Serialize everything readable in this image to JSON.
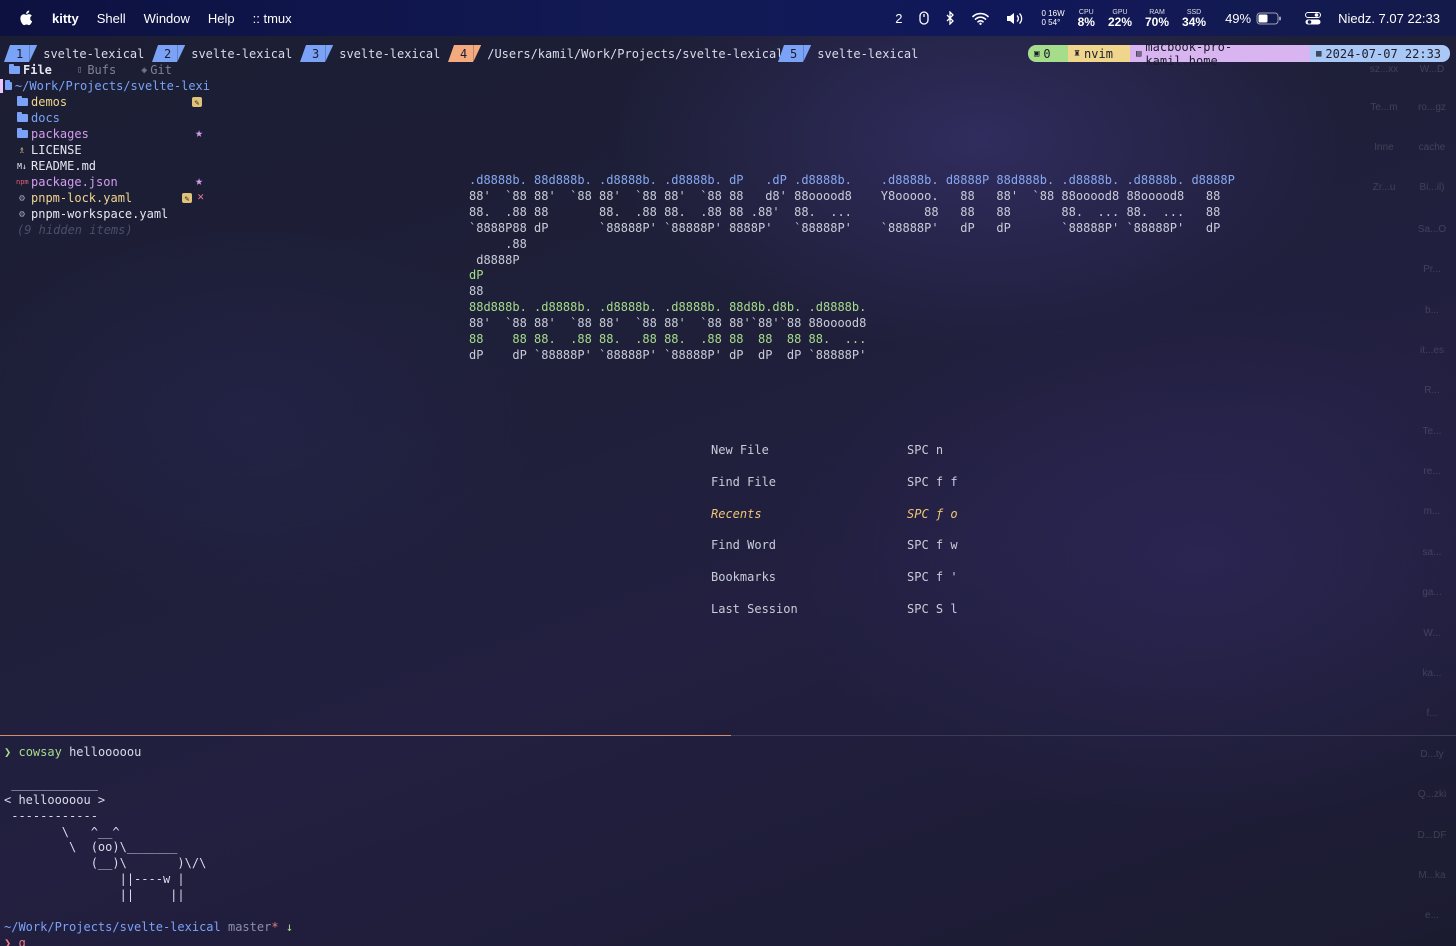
{
  "menubar": {
    "app": "kitty",
    "items": [
      "Shell",
      "Window",
      "Help",
      ":: tmux"
    ],
    "workspace": "2",
    "temp_watts": "16W",
    "temp_deg": "54°",
    "temp_zero1": "0",
    "temp_zero2": "0",
    "cpu_label": "CPU",
    "cpu": "8%",
    "gpu_label": "GPU",
    "gpu": "22%",
    "ram_label": "RAM",
    "ram": "70%",
    "ssd_label": "SSD",
    "ssd": "34%",
    "battery": "49%",
    "clock": "Niedz. 7.07  22:33"
  },
  "tmux": {
    "tabs": [
      {
        "num": "1",
        "name": "svelte-lexical"
      },
      {
        "num": "2",
        "name": "svelte-lexical"
      },
      {
        "num": "3",
        "name": "svelte-lexical"
      },
      {
        "num": "4",
        "name": "/Users/kamil/Work/Projects/svelte-lexical"
      },
      {
        "num": "5",
        "name": "svelte-lexical"
      }
    ],
    "status_session": "0",
    "status_app": "nvim",
    "status_host": "macbook-pro-kamil.home",
    "status_time": "2024-07-07 22:33"
  },
  "tree": {
    "tab_file": "File",
    "tab_bufs": "Bufs",
    "tab_git": "Git",
    "root": "~/Work/Projects/svelte-lexi",
    "items": [
      {
        "name": "demos"
      },
      {
        "name": "docs"
      },
      {
        "name": "packages"
      },
      {
        "name": "LICENSE"
      },
      {
        "name": "README.md"
      },
      {
        "name": "package.json"
      },
      {
        "name": "pnpm-lock.yaml"
      },
      {
        "name": "pnpm-workspace.yaml"
      }
    ],
    "hidden": "(9 hidden items)"
  },
  "logo": {
    "line1": ".d8888b. 88d888b. .d8888b. .d8888b. dP   .dP .d8888b.    .d8888b. d8888P 88d888b. .d8888b. .d8888b. d8888P",
    "line2": "88'  `88 88'  `88 88'  `88 88'  `88 88   d8' 88ooood8    Y8ooooo.   88   88'  `88 88ooood8 88ooood8   88",
    "line3": "88.  .88 88       88.  .88 88.  .88 88 .88'  88.  ...          88   88   88       88.  ... 88.  ...   88",
    "line4": "`8888P88 dP       `88888P' `88888P' 8888P'   `88888P'    `88888P'   dP   dP       `88888P' `88888P'   dP",
    "line5": "     .88",
    "line6": " d8888P",
    "line7": "dP",
    "line8": "88",
    "line9": "88d888b. .d8888b. .d8888b. .d8888b. 88d8b.d8b. .d8888b.",
    "line10": "88'  `88 88'  `88 88'  `88 88'  `88 88'`88'`88 88ooood8",
    "line11": "88    88 88.  .88 88.  .88 88.  .88 88  88  88 88.  ...",
    "line12": "dP    dP `88888P' `88888P' `88888P' dP  dP  dP `88888P'"
  },
  "dashboard": [
    {
      "label": "New File",
      "key": "SPC n"
    },
    {
      "label": "Find File",
      "key": "SPC f f"
    },
    {
      "label": "Recents",
      "key": "SPC ƒ o"
    },
    {
      "label": "Find Word",
      "key": "SPC f w"
    },
    {
      "label": "Bookmarks",
      "key": "SPC f '"
    },
    {
      "label": "Last Session",
      "key": "SPC S l"
    }
  ],
  "terminal": {
    "prompt_char": "❯",
    "cmd": "cowsay",
    "arg": "hellooooou",
    "cow": [
      " ____________",
      "< hellooooou >",
      " ------------",
      "        \\   ^__^",
      "         \\  (oo)\\_______",
      "            (__)\\       )\\/\\",
      "                ||----w |",
      "                ||     ||"
    ],
    "path": "~/Work/Projects/svelte-lexical",
    "branch": "master",
    "dirty": "*",
    "arrow": "↓",
    "input": "q"
  },
  "desktop_labels": [
    "sz...xx",
    "W...D",
    "Te...m",
    "ro...gz",
    "Inne",
    "cache",
    "Zr...u",
    "Bi...il)",
    "Sa...O",
    "Pr...",
    "b...",
    "it...es",
    "R...",
    "Te...",
    "re...",
    "m...",
    "sa...",
    "ga...",
    "W...",
    "ka...",
    "f...",
    "D...ty",
    "Q...zki",
    "D...DF",
    "M...ka",
    "e..."
  ]
}
